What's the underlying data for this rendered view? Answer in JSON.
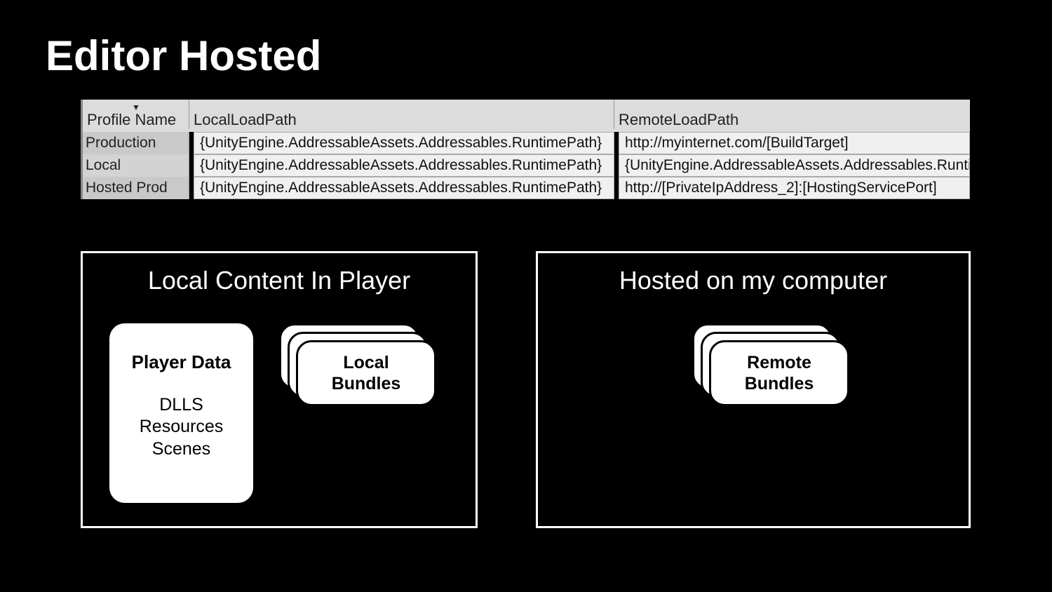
{
  "title": "Editor Hosted",
  "table": {
    "headers": {
      "profile": "Profile Name",
      "local": "LocalLoadPath",
      "remote": "RemoteLoadPath"
    },
    "rows": [
      {
        "profile": "Production",
        "local": "{UnityEngine.AddressableAssets.Addressables.RuntimePath}",
        "remote": "http://myinternet.com/[BuildTarget]"
      },
      {
        "profile": "Local",
        "local": "{UnityEngine.AddressableAssets.Addressables.RuntimePath}",
        "remote": "{UnityEngine.AddressableAssets.Addressables.RuntimePath}"
      },
      {
        "profile": "Hosted Prod",
        "local": "{UnityEngine.AddressableAssets.Addressables.RuntimePath}",
        "remote": "http://[PrivateIpAddress_2]:[HostingServicePort]"
      }
    ]
  },
  "panels": {
    "left": {
      "title": "Local Content In Player"
    },
    "right": {
      "title": "Hosted on my computer"
    }
  },
  "playerData": {
    "title": "Player Data",
    "lines": [
      "DLLS",
      "Resources",
      "Scenes"
    ]
  },
  "stacks": {
    "local": {
      "line1": "Local",
      "line2": "Bundles"
    },
    "remote": {
      "line1": "Remote",
      "line2": "Bundles"
    }
  }
}
